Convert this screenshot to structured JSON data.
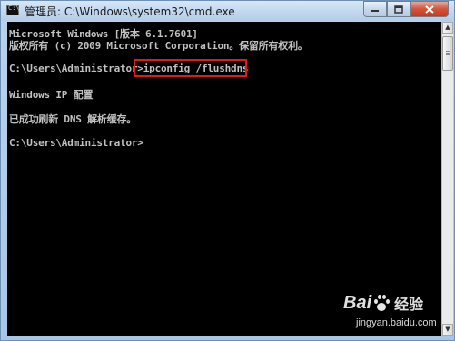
{
  "window": {
    "title": "管理员: C:\\Windows\\system32\\cmd.exe",
    "icon": "cmd-icon",
    "controls": {
      "minimize": "minimize-icon",
      "maximize": "maximize-icon",
      "close": "close-icon"
    }
  },
  "console": {
    "lines": [
      "Microsoft Windows [版本 6.1.7601]",
      "版权所有 (c) 2009 Microsoft Corporation。保留所有权利。",
      "C:\\Users\\Administrator>ipconfig /flushdns",
      "Windows IP 配置",
      "已成功刷新 DNS 解析缓存。",
      "C:\\Users\\Administrator>"
    ],
    "text_color": "#c0c0c0",
    "background_color": "#000000",
    "highlight_color": "#e01a1a"
  },
  "scrollbar": {
    "up": "▲",
    "down": "▼"
  },
  "watermark": {
    "brand_part1": "Bai",
    "brand_part2": "经验",
    "url": "jingyan.baidu.com",
    "icon": "baidu-paw-icon"
  }
}
